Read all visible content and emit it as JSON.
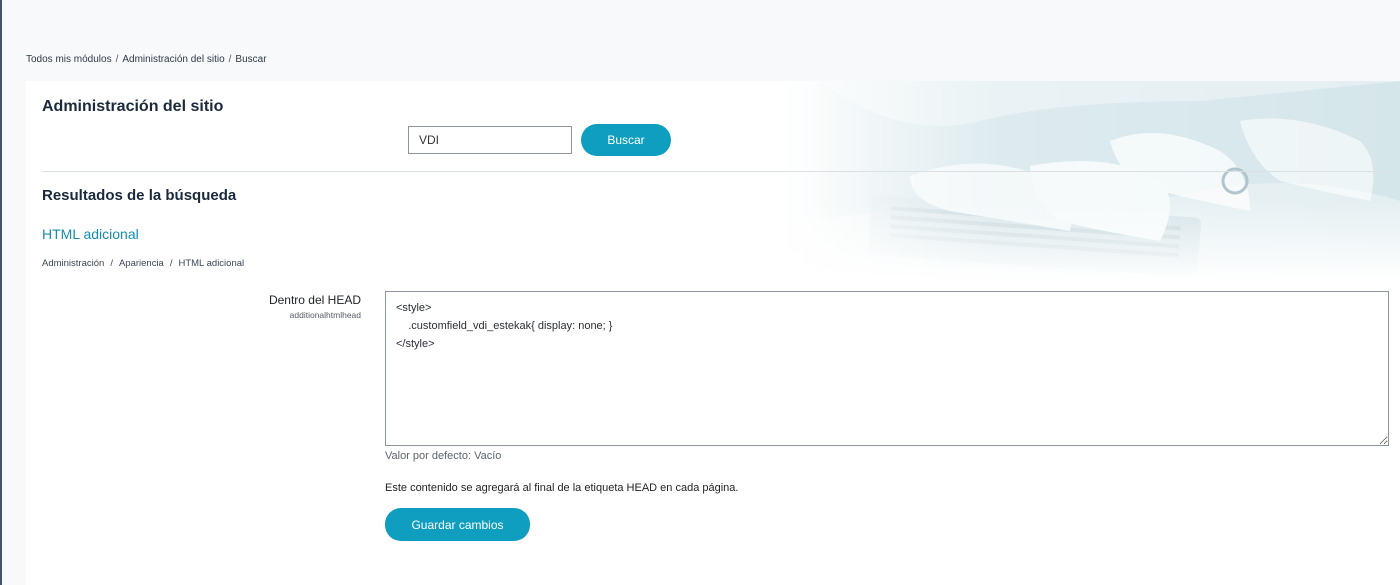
{
  "breadcrumb": {
    "items": [
      "Todos mis módulos",
      "Administración del sitio",
      "Buscar"
    ],
    "separator": "/"
  },
  "card": {
    "title": "Administración del sitio"
  },
  "search": {
    "value": "VDI",
    "button_label": "Buscar"
  },
  "results": {
    "title": "Resultados de la búsqueda",
    "item_title": "HTML adicional",
    "path": [
      "Administración",
      "Apariencia",
      "HTML adicional"
    ],
    "path_separator": "/"
  },
  "setting": {
    "label": "Dentro del HEAD",
    "key": "additionalhtmlhead",
    "value": "<style>\n    .customfield_vdi_estekak{ display: none; }\n</style>",
    "default_value": "Valor por defecto: Vacío",
    "description": "Este contenido se agregará al final de la etiqueta HEAD en cada página.",
    "save_label": "Guardar cambios"
  },
  "colors": {
    "accent": "#0f9ec0",
    "link": "#138eb0",
    "background": "#f8f9fa",
    "card": "#ffffff"
  }
}
